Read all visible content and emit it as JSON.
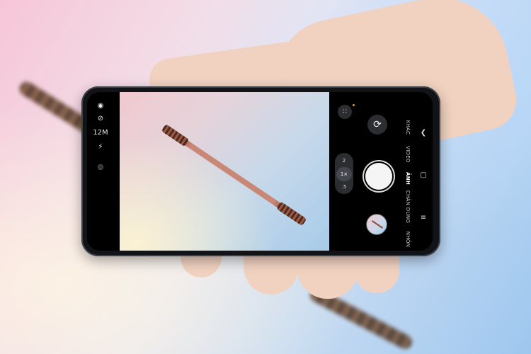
{
  "camera": {
    "left_icons": {
      "flash_off": "⊘",
      "resolution": "12M"
    },
    "zoom_levels": [
      "2",
      "1×",
      ".5"
    ],
    "modes": [
      "KHÁC",
      "VIDEO",
      "ẢNH",
      "CHÂN DUNG",
      "NHỎN"
    ],
    "active_mode": "ẢNH"
  },
  "colors": {
    "shutter": "#f5f5f5",
    "accent_dot": "#f29b38",
    "phone_body": "#111317"
  }
}
